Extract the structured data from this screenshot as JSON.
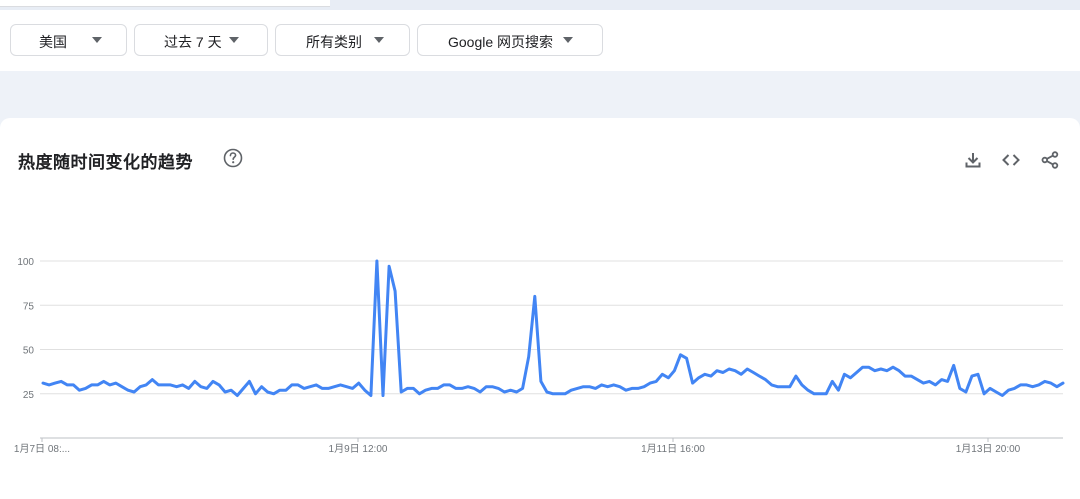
{
  "filters": {
    "region": "美国",
    "time_range": "过去 7 天",
    "category": "所有类别",
    "search_type": "Google 网页搜索"
  },
  "card": {
    "title": "热度随时间变化的趋势"
  },
  "icons": {
    "help": "help-circle-icon",
    "download": "download-icon",
    "embed": "code-icon",
    "share": "share-icon"
  },
  "colors": {
    "series": "#4285f4",
    "grid": "#e0e0e0",
    "tick": "#70757a"
  },
  "chart_data": {
    "type": "line",
    "title": "热度随时间变化的趋势",
    "xlabel": "",
    "ylabel": "",
    "ylim": [
      0,
      100
    ],
    "yticks": [
      25,
      50,
      75,
      100
    ],
    "grid": true,
    "x_tick_labels": [
      "1月7日 08:...",
      "1月9日 12:00",
      "1月11日 16:00",
      "1月13日 20:00"
    ],
    "series": [
      {
        "values": [
          31,
          30,
          31,
          32,
          30,
          30,
          27,
          28,
          30,
          30,
          32,
          30,
          31,
          29,
          27,
          26,
          29,
          30,
          33,
          30,
          30,
          30,
          29,
          30,
          28,
          32,
          29,
          28,
          32,
          30,
          26,
          27,
          24,
          28,
          32,
          25,
          29,
          26,
          25,
          27,
          27,
          30,
          30,
          28,
          29,
          30,
          28,
          28,
          29,
          30,
          29,
          28,
          31,
          27,
          24,
          100,
          24,
          97,
          83,
          26,
          28,
          28,
          25,
          27,
          28,
          28,
          30,
          30,
          28,
          28,
          29,
          28,
          26,
          29,
          29,
          28,
          26,
          27,
          26,
          28,
          46,
          80,
          32,
          26,
          25,
          25,
          25,
          27,
          28,
          29,
          29,
          28,
          30,
          29,
          30,
          29,
          27,
          28,
          28,
          29,
          31,
          32,
          36,
          34,
          38,
          47,
          45,
          31,
          34,
          36,
          35,
          38,
          37,
          39,
          38,
          36,
          39,
          37,
          35,
          33,
          30,
          29,
          29,
          29,
          35,
          30,
          27,
          25,
          25,
          25,
          32,
          27,
          36,
          34,
          37,
          40,
          40,
          38,
          39,
          38,
          40,
          38,
          35,
          35,
          33,
          31,
          32,
          30,
          33,
          32,
          41,
          28,
          26,
          35,
          36,
          25,
          28,
          26,
          24,
          27,
          28,
          30,
          30,
          29,
          30,
          32,
          31,
          29,
          31
        ]
      }
    ]
  }
}
